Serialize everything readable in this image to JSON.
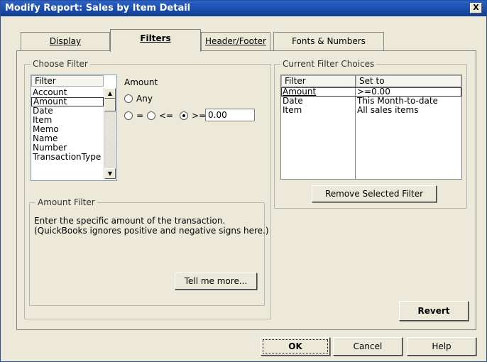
{
  "window": {
    "title": "Modify Report: Sales by Item Detail",
    "close_label": "X"
  },
  "tabs": [
    {
      "label": "Display",
      "mnemonic_index": 0
    },
    {
      "label": "Filters",
      "mnemonic_index": 0
    },
    {
      "label": "Header/Footer",
      "mnemonic_index": 0
    },
    {
      "label": "Fonts & Numbers",
      "mnemonic_index": 2
    }
  ],
  "active_tab": "Filters",
  "choose_filter": {
    "legend": "Choose Filter",
    "list_header": "Filter",
    "items": [
      "Account",
      "Amount",
      "Date",
      "Item",
      "Memo",
      "Name",
      "Number",
      "TransactionType"
    ],
    "selected": "Amount",
    "amount_label": "Amount",
    "any_label": "Any",
    "eq_label": "=",
    "le_label": "<=",
    "ge_label": ">=",
    "selected_operator": ">=",
    "amount_value": "0.00"
  },
  "amount_filter": {
    "legend": "Amount Filter",
    "description_line1": "Enter the specific amount of the transaction.",
    "description_line2": "(QuickBooks ignores positive and negative signs here.)",
    "tell_me_more": "Tell me more..."
  },
  "current_filters": {
    "legend": "Current Filter Choices",
    "col_filter": "Filter",
    "col_set_to": "Set to",
    "rows": [
      {
        "filter": "Amount",
        "set_to": ">=0.00"
      },
      {
        "filter": "Date",
        "set_to": "This Month-to-date"
      },
      {
        "filter": "Item",
        "set_to": "All sales items"
      }
    ],
    "remove_button": "Remove Selected Filter"
  },
  "revert_button": "Revert",
  "footer": {
    "ok": "OK",
    "cancel": "Cancel",
    "help": "Help"
  }
}
